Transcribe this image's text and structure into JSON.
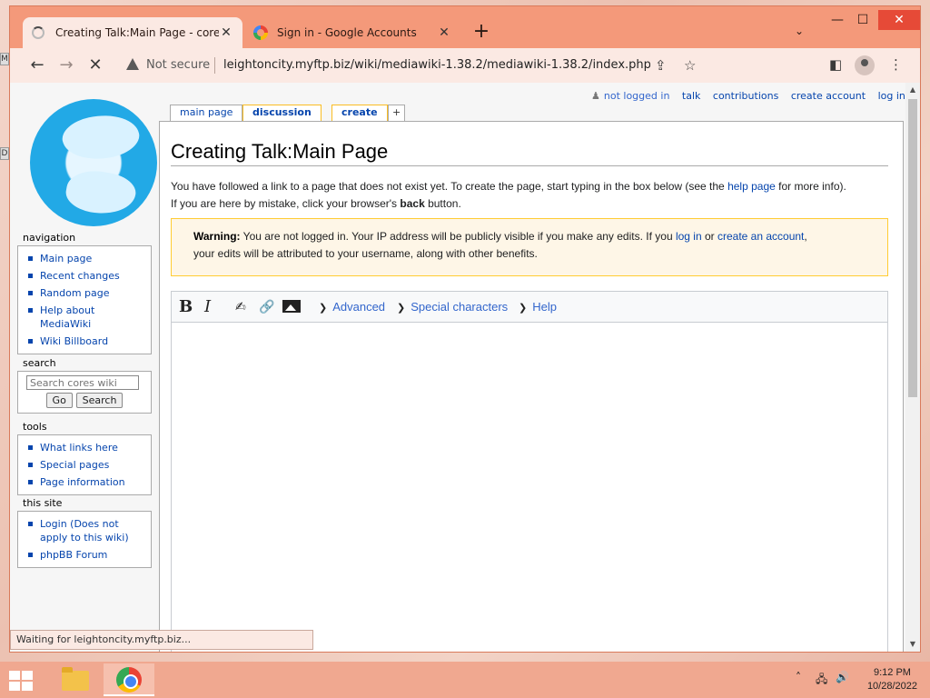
{
  "browser": {
    "tabs": [
      {
        "title": "Creating Talk:Main Page - cores w",
        "active": true
      },
      {
        "title": "Sign in - Google Accounts",
        "active": false
      }
    ],
    "new_tab_label": "+",
    "omnibox": {
      "security_label": "Not secure",
      "url": "leightoncity.myftp.biz/wiki/mediawiki-1.38.2/mediawiki-1.38.2/index.php?title=Talk:Main_Pag..."
    },
    "status": "Waiting for leightoncity.myftp.biz..."
  },
  "wiki": {
    "personal_tools": {
      "user": "not logged in",
      "talk": "talk",
      "contributions": "contributions",
      "create_account": "create account",
      "login": "log in"
    },
    "page_tabs": {
      "main_page": "main page",
      "discussion": "discussion",
      "create": "create",
      "more": "+"
    },
    "sidebar": {
      "navigation": {
        "heading": "navigation",
        "items": [
          "Main page",
          "Recent changes",
          "Random page",
          "Help about MediaWiki",
          "Wiki Billboard"
        ]
      },
      "search": {
        "heading": "search",
        "placeholder": "Search cores wiki",
        "go": "Go",
        "search": "Search"
      },
      "tools": {
        "heading": "tools",
        "items": [
          "What links here",
          "Special pages",
          "Page information"
        ]
      },
      "this_site": {
        "heading": "this site",
        "items": [
          "Login (Does not apply to this wiki)",
          "phpBB Forum"
        ]
      }
    },
    "title": "Creating Talk:Main Page",
    "intro": {
      "part1": "You have followed a link to a page that does not exist yet. To create the page, start typing in the box below (see the ",
      "help_link": "help page",
      "part2": " for more info).",
      "line2a": "If you are here by mistake, click your browser's ",
      "back": "back",
      "line2b": " button."
    },
    "warning": {
      "label": "Warning:",
      "text1": " You are not logged in. Your IP address will be publicly visible if you make any edits. If you ",
      "login_link": "log in",
      "text2": " or ",
      "create_link": "create an account",
      "text3": ",",
      "line2": "your edits will be attributed to your username, along with other benefits."
    },
    "editor": {
      "bold": "B",
      "italic": "I",
      "advanced": "Advanced",
      "special_characters": "Special characters",
      "help": "Help"
    }
  },
  "taskbar": {
    "time": "9:12 PM",
    "date": "10/28/2022"
  }
}
